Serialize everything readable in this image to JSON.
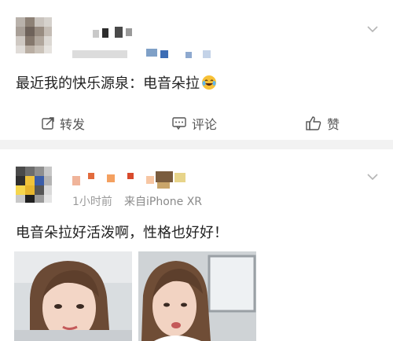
{
  "post1": {
    "text": "最近我的快乐源泉：电音朵拉",
    "emoji": "laughing-tears-emoji",
    "actions": {
      "repost_label": "转发",
      "comment_label": "评论",
      "like_label": "赞"
    }
  },
  "post2": {
    "time": "1小时前",
    "source": "来自iPhone XR",
    "text": "电音朵拉好活泼啊，性格也好好！"
  },
  "colors": {
    "page_bg": "#f2f2f2",
    "card_bg": "#ffffff",
    "text": "#222222",
    "meta": "#9a9a9a"
  }
}
